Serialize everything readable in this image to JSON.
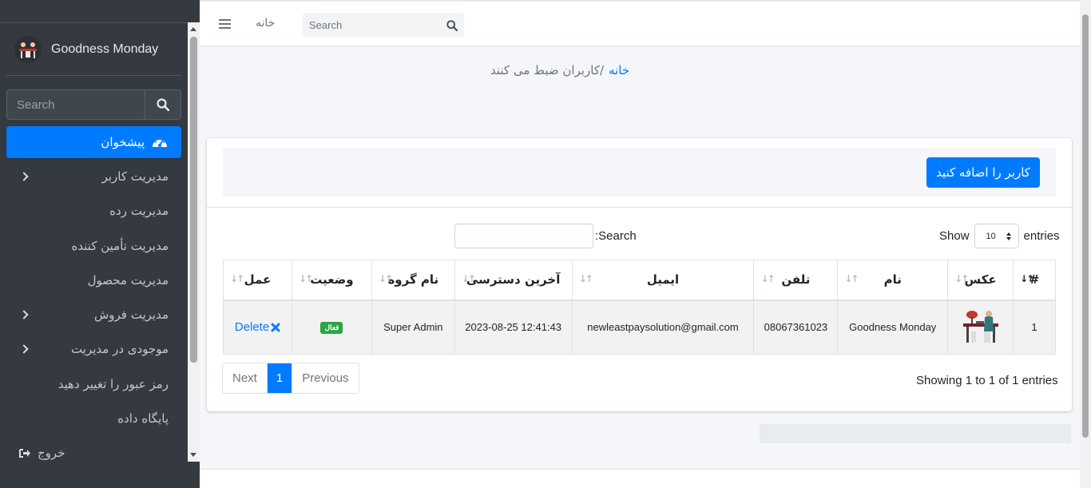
{
  "sidebar": {
    "brand": "Goodness Monday",
    "search_placeholder": "Search",
    "items": [
      {
        "label": "پیشخوان",
        "icon": "dashboard-icon",
        "active": true
      },
      {
        "label": "مدیریت کاربر",
        "has_children": true
      },
      {
        "label": "مدیریت رده"
      },
      {
        "label": "مدیریت تأمین کننده"
      },
      {
        "label": "مدیریت محصول"
      },
      {
        "label": "مدیریت فروش",
        "has_children": true
      },
      {
        "label": "موجودی در مدیریت",
        "has_children": true
      },
      {
        "label": "رمز عبور را تغییر دهید"
      },
      {
        "label": "پایگاه داده"
      },
      {
        "label": "خروج",
        "icon": "sign-out-icon"
      }
    ]
  },
  "topbar": {
    "home": "خانه",
    "search_placeholder": "Search"
  },
  "breadcrumb": {
    "home": "خانه",
    "current": "/کاربران ضبط می کنند"
  },
  "card": {
    "add_button": "کاربر را اضافه کنید",
    "show_label": "Show",
    "entries_value": "10",
    "entries_label": "entries",
    "search_label": ":Search",
    "columns": [
      "#",
      "عکس",
      "نام",
      "تلفن",
      "ایمیل",
      "آخرین دسترسی",
      "نام گروه",
      "وضعیت",
      "عمل"
    ],
    "rows": [
      {
        "num": "1",
        "name": "Goodness Monday",
        "phone": "08067361023",
        "email": "newleastpaysolution@gmail.com",
        "last_access": "12:41:43 2023-08-25",
        "group": "Super Admin",
        "status": "فعال",
        "action": "Delete"
      }
    ],
    "pagination": {
      "next": "Next",
      "current": "1",
      "previous": "Previous"
    },
    "showing": "Showing 1 to 1 of 1 entries"
  },
  "colors": {
    "sidebar_bg": "#343a40",
    "primary": "#007bff",
    "success": "#28a745"
  }
}
